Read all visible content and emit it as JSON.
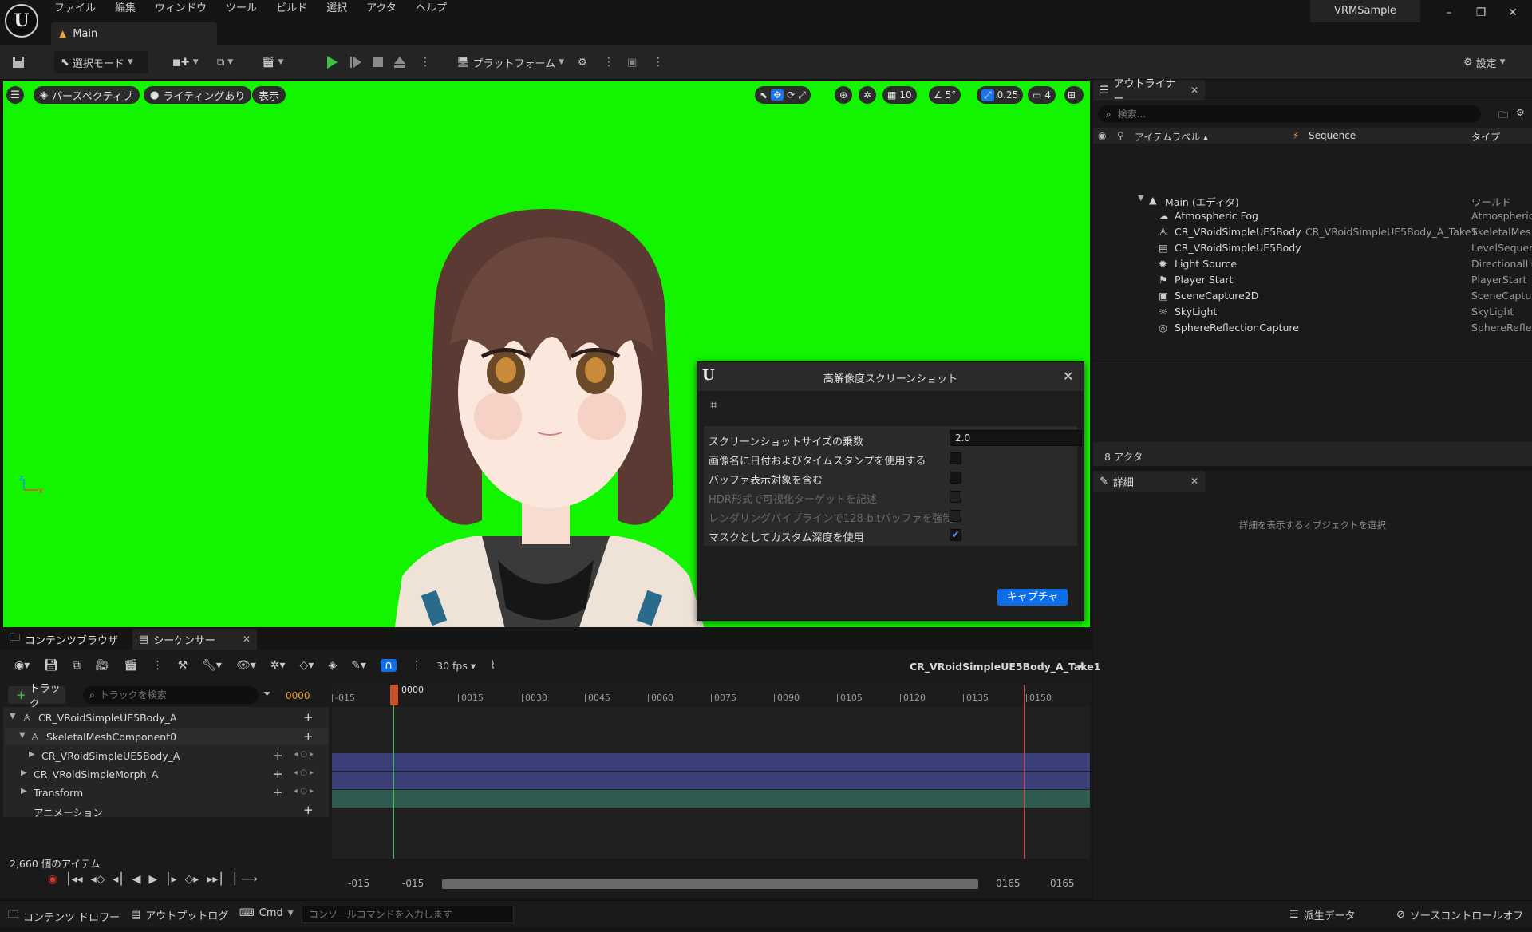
{
  "menubar": {
    "items": [
      "ファイル",
      "編集",
      "ウィンドウ",
      "ツール",
      "ビルド",
      "選択",
      "アクタ",
      "ヘルプ"
    ]
  },
  "level_tab": {
    "label": "Main"
  },
  "project": {
    "name": "VRMSample"
  },
  "toolbar": {
    "select_mode": "選択モード",
    "platform": "プラットフォーム",
    "settings": "設定"
  },
  "viewport": {
    "perspective": "パースペクティブ",
    "lighting": "ライティングあり",
    "show": "表示",
    "grid_snap": "10",
    "rotate_snap": "5°",
    "scale_snap": "0.25",
    "camera_speed": "4",
    "axis_z": "z",
    "axis_x": "x"
  },
  "screenshot_dialog": {
    "title": "高解像度スクリーンショット",
    "options": [
      {
        "label": "スクリーンショットサイズの乗数",
        "value": "2.0",
        "kind": "input"
      },
      {
        "label": "画像名に日付およびタイムスタンプを使用する",
        "checked": false,
        "disabled": false
      },
      {
        "label": "バッファ表示対象を含む",
        "checked": false,
        "disabled": false
      },
      {
        "label": "HDR形式で可視化ターゲットを記述",
        "checked": false,
        "disabled": true
      },
      {
        "label": "レンダリングパイプラインで128-bitバッファを強制",
        "checked": false,
        "disabled": true
      },
      {
        "label": "マスクとしてカスタム深度を使用",
        "checked": true,
        "disabled": false
      }
    ],
    "capture_label": "キャプチャ"
  },
  "outliner": {
    "tab": "アウトライナー",
    "search_placeholder": "検索...",
    "col_label": "アイテムラベル ▴",
    "col_sequence": "Sequence",
    "col_type": "タイプ",
    "rows": [
      {
        "label": "Main (エディタ)",
        "sequence": "",
        "type": "ワールド",
        "icon": "level-icon"
      },
      {
        "label": "Atmospheric Fog",
        "sequence": "",
        "type": "Atmospheric",
        "icon": "fog-icon"
      },
      {
        "label": "CR_VRoidSimpleUE5Body",
        "sequence": "CR_VRoidSimpleUE5Body_A_Take1",
        "type": "SkeletalMes",
        "icon": "skeletal-mesh-icon"
      },
      {
        "label": "CR_VRoidSimpleUE5Body",
        "sequence": "",
        "type": "LevelSequer",
        "icon": "level-sequence-icon"
      },
      {
        "label": "Light Source",
        "sequence": "",
        "type": "DirectionalLi",
        "icon": "light-icon"
      },
      {
        "label": "Player Start",
        "sequence": "",
        "type": "PlayerStart",
        "icon": "player-start-icon"
      },
      {
        "label": "SceneCapture2D",
        "sequence": "",
        "type": "SceneCaptur",
        "icon": "scene-capture-icon"
      },
      {
        "label": "SkyLight",
        "sequence": "",
        "type": "SkyLight",
        "icon": "skylight-icon"
      },
      {
        "label": "SphereReflectionCapture",
        "sequence": "",
        "type": "SphereReflec",
        "icon": "reflection-icon"
      }
    ],
    "actor_count": "8 アクタ"
  },
  "details": {
    "tab": "詳細",
    "empty_message": "詳細を表示するオブジェクトを選択"
  },
  "bottom_tabs": {
    "content_browser": "コンテンツブラウザ",
    "sequencer": "シーケンサー"
  },
  "sequencer": {
    "fps": "30 fps",
    "sequence_name": "CR_VRoidSimpleUE5Body_A_Take1",
    "add_track": "トラック",
    "search_placeholder": "トラックを検索",
    "current_frame": "0000",
    "playhead_label": "0000",
    "tracks": [
      {
        "label": "CR_VRoidSimpleUE5Body_A",
        "level": 0
      },
      {
        "label": "SkeletalMeshComponent0",
        "level": 1
      },
      {
        "label": "CR_VRoidSimpleUE5Body_A",
        "level": 2
      },
      {
        "label": "CR_VRoidSimpleMorph_A",
        "level": 1
      },
      {
        "label": "Transform",
        "level": 1
      },
      {
        "label": "アニメーション",
        "level": 1
      }
    ],
    "ruler_ticks": [
      "-015",
      "0015",
      "0030",
      "0045",
      "0060",
      "0075",
      "0090",
      "0105",
      "0120",
      "0135",
      "0150"
    ],
    "item_count": "2,660 個のアイテム",
    "range_start_a": "-015",
    "range_start_b": "-015",
    "range_end_a": "0165",
    "range_end_b": "0165"
  },
  "statusbar": {
    "content_drawer": "コンテンツ ドロワー",
    "output_log": "アウトプットログ",
    "cmd": "Cmd",
    "console_placeholder": "コンソールコマンドを入力します",
    "derived_data": "派生データ",
    "source_control": "ソースコントロールオフ"
  },
  "colors": {
    "green_screen": "#13f500",
    "accent_blue": "#0d6ee8",
    "track_purple": "#3a3f78",
    "track_teal": "#2f5a50"
  }
}
